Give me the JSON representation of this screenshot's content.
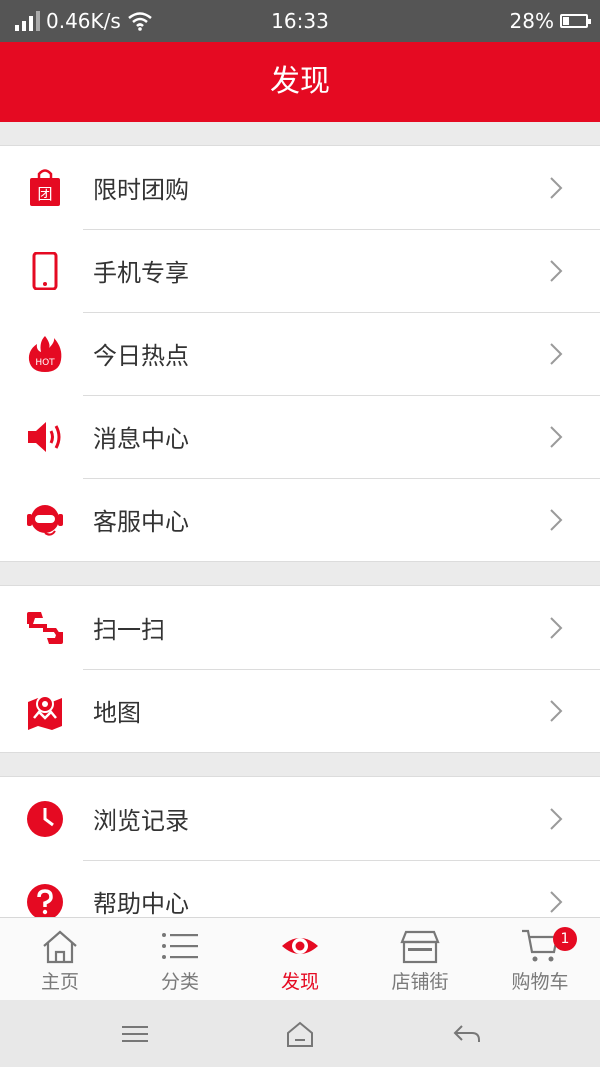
{
  "status_bar": {
    "network_speed": "0.46K/s",
    "time": "16:33",
    "battery": "28%",
    "battery_level": 0.28
  },
  "header": {
    "title": "发现"
  },
  "groups": [
    {
      "items": [
        {
          "label": "限时团购",
          "icon": "shopping-bag-icon"
        },
        {
          "label": "手机专享",
          "icon": "mobile-phone-icon"
        },
        {
          "label": "今日热点",
          "icon": "hot-flame-icon"
        },
        {
          "label": "消息中心",
          "icon": "speaker-icon"
        },
        {
          "label": "客服中心",
          "icon": "customer-service-icon"
        }
      ]
    },
    {
      "items": [
        {
          "label": "扫一扫",
          "icon": "scan-icon"
        },
        {
          "label": "地图",
          "icon": "map-icon"
        }
      ]
    },
    {
      "items": [
        {
          "label": "浏览记录",
          "icon": "clock-icon"
        },
        {
          "label": "帮助中心",
          "icon": "help-icon"
        }
      ]
    }
  ],
  "icon_texts": {
    "group_buy": "团",
    "hot": "HOT"
  },
  "tabs": [
    {
      "label": "主页",
      "icon": "home-icon"
    },
    {
      "label": "分类",
      "icon": "list-icon"
    },
    {
      "label": "发现",
      "icon": "eye-icon",
      "active": true
    },
    {
      "label": "店铺街",
      "icon": "store-icon"
    },
    {
      "label": "购物车",
      "icon": "cart-icon",
      "badge": "1"
    }
  ],
  "colors": {
    "accent": "#e50a22",
    "status_bar": "#555555",
    "background": "#ebebeb"
  }
}
